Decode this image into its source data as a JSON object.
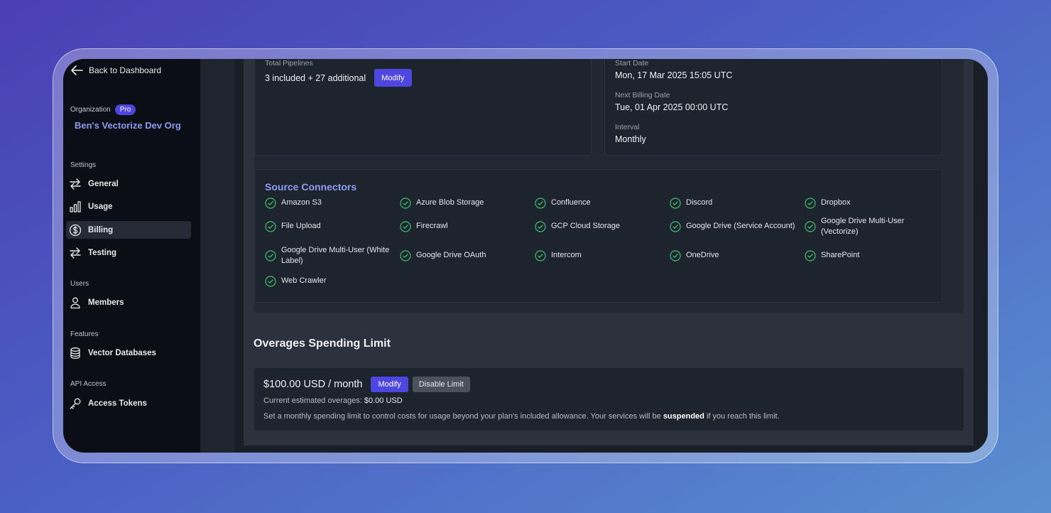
{
  "sidebar": {
    "back_label": "Back to Dashboard",
    "org_label": "Organization",
    "plan_badge": "Pro",
    "org_name": "Ben's Vectorize Dev Org",
    "sections": {
      "settings": "Settings",
      "users": "Users",
      "features": "Features",
      "api_access": "API Access"
    },
    "items": {
      "general": "General",
      "usage": "Usage",
      "billing": "Billing",
      "testing": "Testing",
      "members": "Members",
      "vector_databases": "Vector Databases",
      "access_tokens": "Access Tokens"
    },
    "active_item": "Billing"
  },
  "plan": {
    "pipelines_label": "Total Pipelines",
    "pipelines_value": "3 included + 27 additional",
    "modify_label": "Modify",
    "start_date_label": "Start Date",
    "start_date_value": "Mon, 17 Mar 2025 15:05 UTC",
    "next_billing_label": "Next Billing Date",
    "next_billing_value": "Tue, 01 Apr 2025 00:00 UTC",
    "interval_label": "Interval",
    "interval_value": "Monthly"
  },
  "source_connectors": {
    "title": "Source Connectors",
    "items": [
      "Amazon S3",
      "Azure Blob Storage",
      "Confluence",
      "Discord",
      "Dropbox",
      "File Upload",
      "Firecrawl",
      "GCP Cloud Storage",
      "Google Drive (Service Account)",
      "Google Drive Multi-User (Vectorize)",
      "Google Drive Multi-User (White Label)",
      "Google Drive OAuth",
      "Intercom",
      "OneDrive",
      "SharePoint",
      "Web Crawler"
    ]
  },
  "overages": {
    "title": "Overages Spending Limit",
    "limit_value": "$100.00 USD / month",
    "modify_label": "Modify",
    "disable_label": "Disable Limit",
    "current_label": "Current estimated overages:",
    "current_value": "$0.00 USD",
    "note_prefix": "Set a monthly spending limit to control costs for usage beyond your plan's included allowance. Your services will be",
    "note_bold": "suspended",
    "note_suffix": "if you reach this limit."
  },
  "colors": {
    "accent": "#4d46e0",
    "link": "#8c9cf2",
    "check": "#3fbf6f"
  }
}
